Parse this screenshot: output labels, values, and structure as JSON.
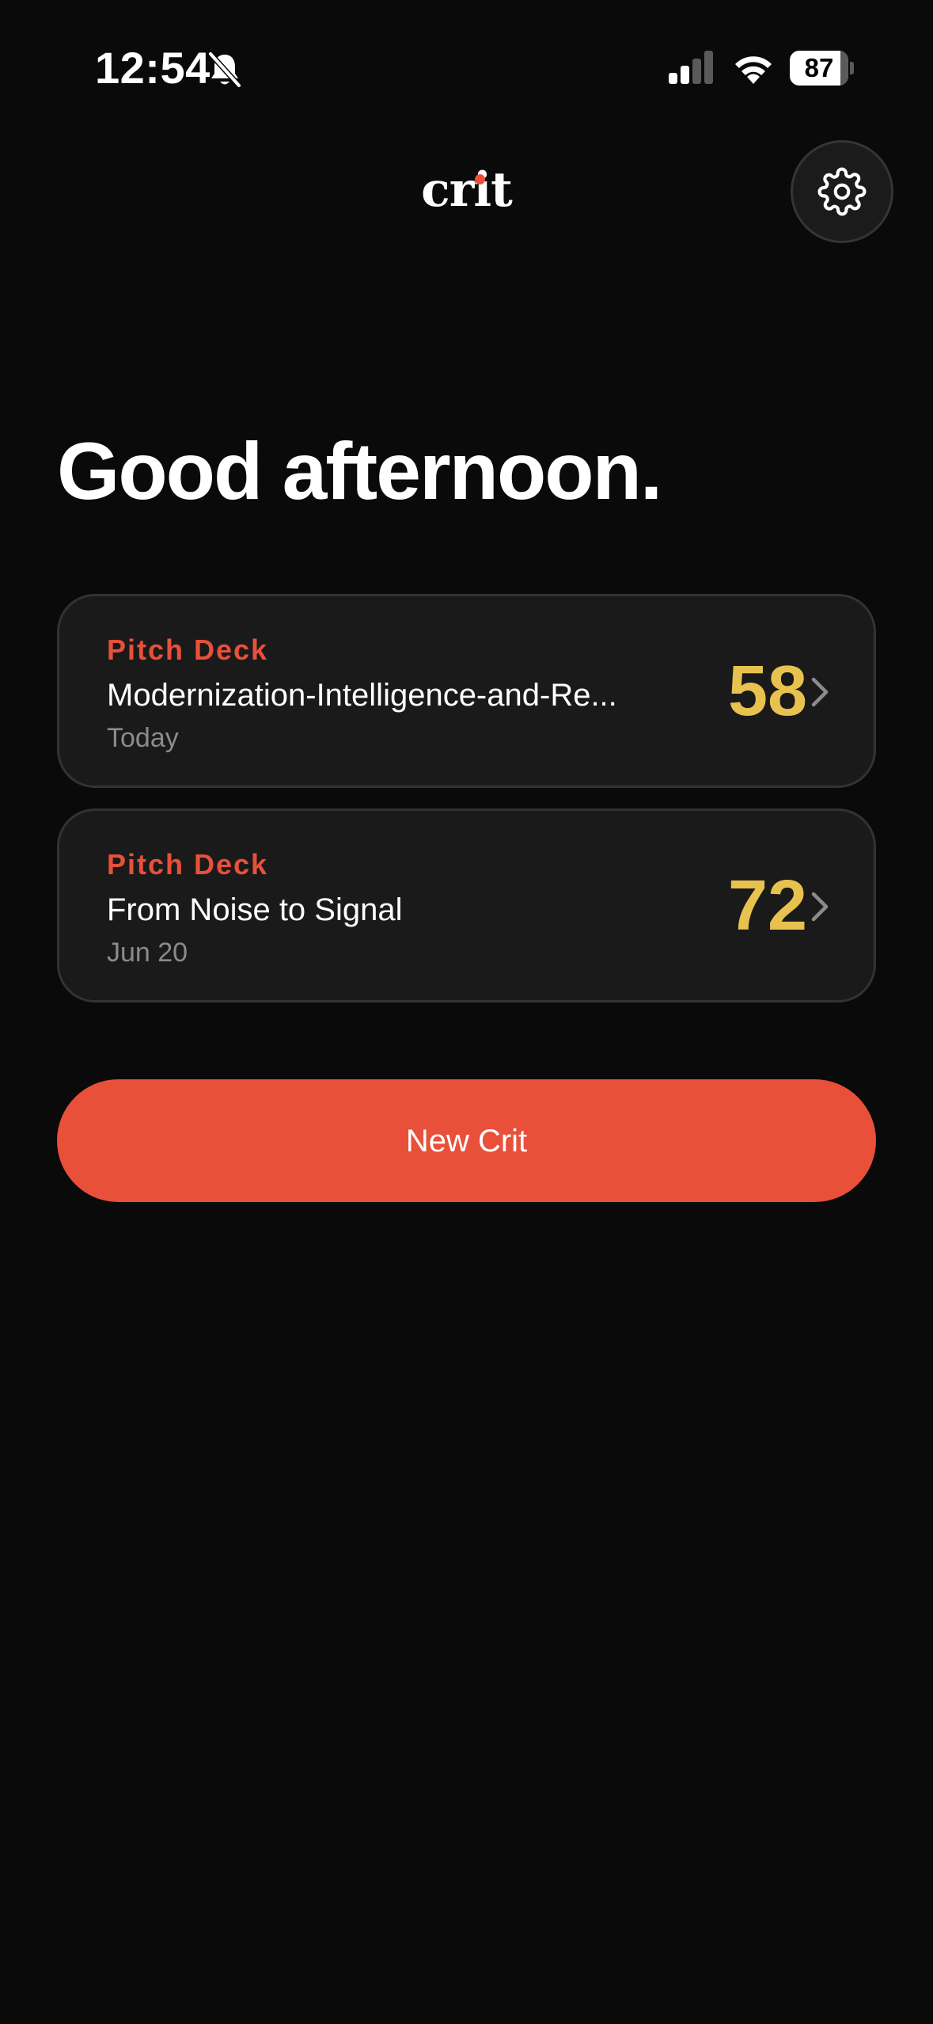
{
  "status_bar": {
    "time": "12:54",
    "battery_level": "87",
    "battery_fraction": 0.87,
    "icons": [
      "bell-slash-icon",
      "signal-icon",
      "wifi-icon",
      "battery-icon"
    ]
  },
  "header": {
    "logo_text": "crit",
    "settings_icon": "gear-icon"
  },
  "main": {
    "greeting": "Good afternoon.",
    "crits": [
      {
        "category": "Pitch Deck",
        "title": "Modernization-Intelligence-and-Re...",
        "date": "Today",
        "score": "58"
      },
      {
        "category": "Pitch Deck",
        "title": "From Noise to Signal",
        "date": "Jun 20",
        "score": "72"
      }
    ],
    "new_crit_label": "New Crit"
  },
  "colors": {
    "background": "#0a0a0a",
    "card_background": "#1b1a1a",
    "accent": "#e8503a",
    "score": "#e8c24f",
    "muted_text": "#8d8a8a"
  }
}
